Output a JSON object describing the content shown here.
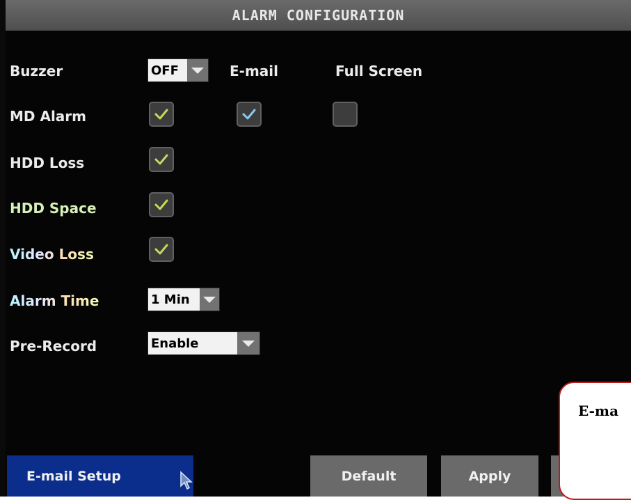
{
  "title": "ALARM CONFIGURATION",
  "rows": {
    "buzzer": {
      "label": "Buzzer",
      "value": "OFF"
    },
    "md_alarm": {
      "label": "MD Alarm"
    },
    "hdd_loss": {
      "label": "HDD Loss"
    },
    "hdd_space": {
      "label": "HDD Space"
    },
    "video_loss": {
      "label": "Video Loss"
    },
    "alarm_time": {
      "label": "Alarm Time",
      "value": "1 Min"
    },
    "pre_record": {
      "label": "Pre-Record",
      "value": "Enable"
    }
  },
  "columns": {
    "email": "E-mail",
    "full_screen": "Full Screen"
  },
  "checkboxes": {
    "md_alarm_buzzer": true,
    "md_alarm_email": true,
    "md_alarm_full_screen": false,
    "hdd_loss_buzzer": true,
    "hdd_space_buzzer": true,
    "video_loss_buzzer": true
  },
  "buttons": {
    "email_setup": "E-mail Setup",
    "default": "Default",
    "apply": "Apply"
  },
  "callout": {
    "text": "E-ma"
  },
  "colors": {
    "title_bar": "#5e5e5e",
    "primary_button": "#0b2e8c",
    "check_yellow": "#c8d85a",
    "check_blue": "#8cc8f0",
    "callout_border": "#b81c1c"
  }
}
